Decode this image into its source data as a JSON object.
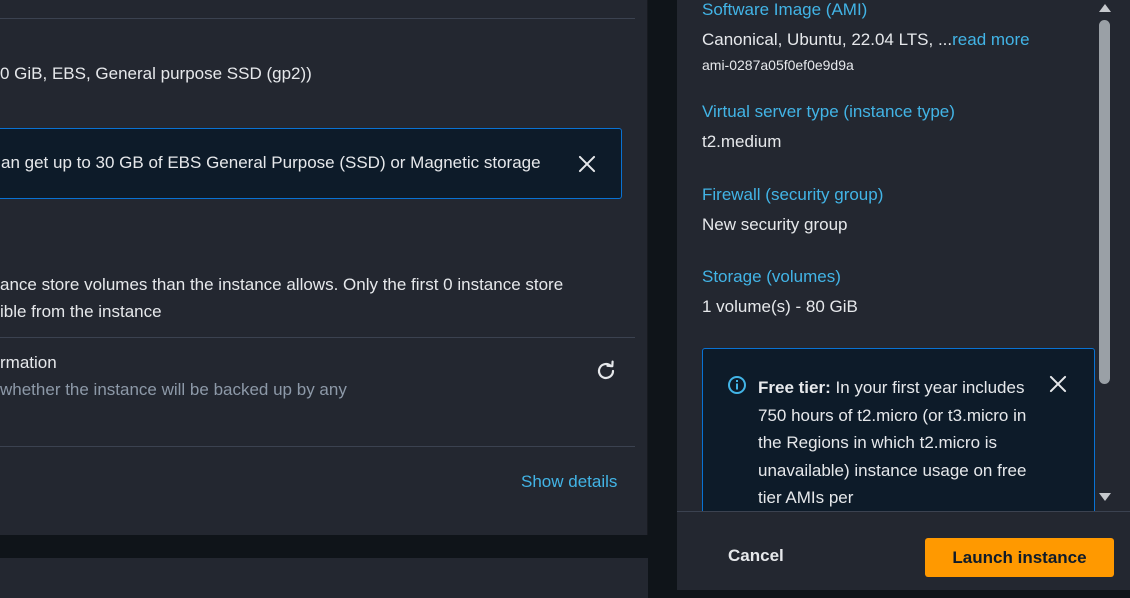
{
  "config": {
    "storage_summary": "0 GiB, EBS, General purpose SSD (gp2))",
    "free_tier_alert": "an get up to 30 GB of EBS General Purpose (SSD) or Magnetic storage",
    "instance_store_warning": {
      "line1": "ance store volumes than the instance allows. Only the first 0 instance store",
      "line2": "ible from the instance"
    },
    "backup_info": {
      "title": "rmation",
      "description": "whether the instance will be backed up by any"
    },
    "show_details": "Show details"
  },
  "summary": {
    "ami": {
      "label": "Software Image (AMI)",
      "value": "Canonical, Ubuntu, 22.04 LTS, ...",
      "read_more": "read more",
      "id": "ami-0287a05f0ef0e9d9a"
    },
    "instance_type": {
      "label": "Virtual server type (instance type)",
      "value": "t2.medium"
    },
    "firewall": {
      "label": "Firewall (security group)",
      "value": "New security group"
    },
    "storage": {
      "label": "Storage (volumes)",
      "value": "1 volume(s) - 80 GiB"
    },
    "free_tier": {
      "title": "Free tier:",
      "body": "In your first year includes 750 hours of t2.micro (or t3.micro in the Regions in which t2.micro is unavailable) instance usage on free tier AMIs per"
    }
  },
  "footer": {
    "cancel": "Cancel",
    "launch": "Launch instance"
  },
  "colors": {
    "accent_link": "#42b4e6",
    "primary_button": "#ff9900",
    "info_border": "#0972d3",
    "panel_bg": "#232730"
  }
}
